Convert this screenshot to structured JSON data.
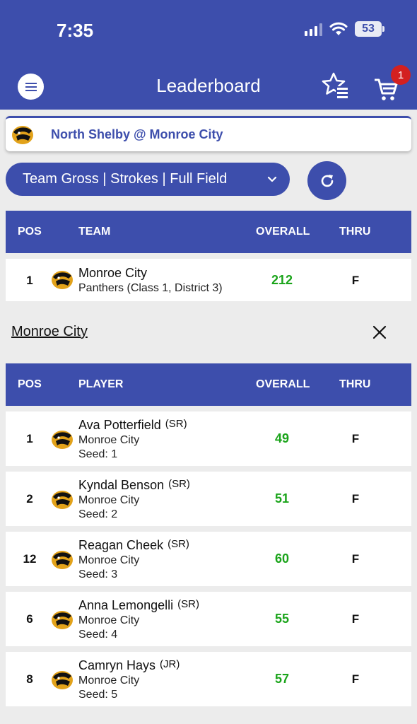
{
  "status_bar": {
    "time": "7:35",
    "battery": "53"
  },
  "header": {
    "title": "Leaderboard",
    "cart_count": "1"
  },
  "event": {
    "title": "North Shelby @ Monroe City"
  },
  "filter": {
    "label": "Team Gross | Strokes | Full Field"
  },
  "team_table": {
    "columns": {
      "pos": "POS",
      "name": "TEAM",
      "overall": "OVERALL",
      "thru": "THRU"
    },
    "rows": [
      {
        "pos": "1",
        "name": "Monroe City",
        "subtitle": "Panthers (Class 1, District 3)",
        "overall": "212",
        "thru": "F"
      }
    ]
  },
  "selected_team": {
    "name": "Monroe City"
  },
  "player_table": {
    "columns": {
      "pos": "POS",
      "name": "PLAYER",
      "overall": "OVERALL",
      "thru": "THRU"
    },
    "rows": [
      {
        "pos": "1",
        "name": "Ava Potterfield",
        "class": "(SR)",
        "team": "Monroe City",
        "seed": "Seed: 1",
        "overall": "49",
        "thru": "F"
      },
      {
        "pos": "2",
        "name": "Kyndal Benson",
        "class": "(SR)",
        "team": "Monroe City",
        "seed": "Seed: 2",
        "overall": "51",
        "thru": "F"
      },
      {
        "pos": "12",
        "name": "Reagan Cheek",
        "class": "(SR)",
        "team": "Monroe City",
        "seed": "Seed: 3",
        "overall": "60",
        "thru": "F"
      },
      {
        "pos": "6",
        "name": "Anna Lemongelli",
        "class": "(SR)",
        "team": "Monroe City",
        "seed": "Seed: 4",
        "overall": "55",
        "thru": "F"
      },
      {
        "pos": "8",
        "name": "Camryn Hays",
        "class": "(JR)",
        "team": "Monroe City",
        "seed": "Seed: 5",
        "overall": "57",
        "thru": "F"
      }
    ]
  },
  "colors": {
    "primary": "#3d4eac",
    "score_green": "#1aa41a",
    "badge_red": "#d32020"
  },
  "icons": [
    "menu-icon",
    "star-list-icon",
    "cart-icon",
    "refresh-icon",
    "chevron-down-icon",
    "close-icon",
    "panther-logo-icon"
  ]
}
